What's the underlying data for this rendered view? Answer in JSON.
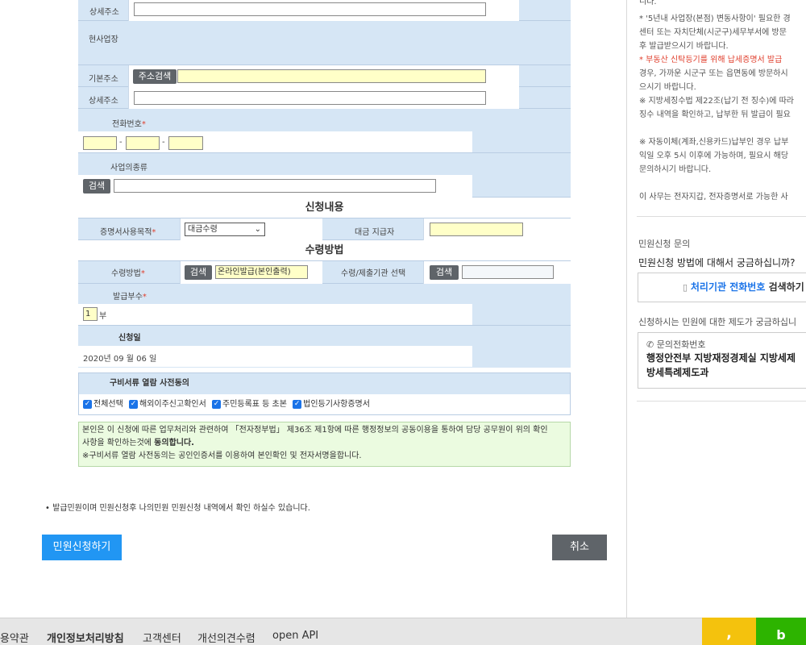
{
  "form": {
    "detail_addr_label_1": "상세주소",
    "workplace_label": "현사업장",
    "basic_addr_label": "기본주소",
    "addr_search_btn": "주소검색",
    "detail_addr_label_2": "상세주소",
    "phone_label": "전화번호",
    "phone_sep_1": "-",
    "phone_sep_2": "-",
    "business_type_label": "사업의종류",
    "search_btn": "검색",
    "section_apply": "신청내용",
    "purpose_label": "증명서사용목적",
    "purpose_value": "대금수령",
    "payer_label": "대금 지급자",
    "section_receive": "수령방법",
    "receive_method_label": "수령방법",
    "receive_search_btn": "검색",
    "receive_method_value": "온라인발급(본인출력)",
    "receive_org_label": "수령/제출기관 선택",
    "receive_org_search_btn": "검색",
    "copies_label": "발급부수",
    "copies_value": "1",
    "copies_unit": "부",
    "apply_date_label": "신청일",
    "apply_date_value": "2020년 09 월 06 일",
    "required_mark": "*"
  },
  "agreement": {
    "title": "구비서류 열람 사전동의",
    "items": [
      "전체선택",
      "해외이주신고확인서",
      "주민등록표 등 초본",
      "법인등기사항증명서"
    ]
  },
  "notice": {
    "line1": "본인은 이 신청에 따른 업무처리와 관련하여 「전자정부법」 제36조 제1항에 따른 행정정보의 공동이용을 통하여 담당 공무원이 위의 확인",
    "line2a": "사항을 확인하는것에 ",
    "line2b": "동의합니다.",
    "line3": "※구비서류 열람 사전동의는 공인인증서를 이용하여 본인확인 및 전자서명을합니다."
  },
  "bullet_note": "발급민원이며 민원신청후 나의민원 민원신청 내역에서 확인 하실수 있습니다.",
  "buttons": {
    "submit": "민원신청하기",
    "cancel": "취소"
  },
  "right": {
    "lines": [
      "니다.",
      " * '5년내 사업장(본점) 변동사항이' 필요한 경",
      "센터 또는 자치단체(시군구)세무부서에 방문",
      "후 발급받으시기 바랍니다.",
      " * 부동산 신탁등기를 위해 납세증명서 발급",
      "경우, 가까운 시군구 또는 읍면동에 방문하시",
      "으시기 바랍니다.",
      "※ 지방세징수법 제22조(납기 전 징수)에 따라",
      "징수 내역을 확인하고, 납부한 뒤 발급이 필요",
      "※ 자동이체(계좌,신용카드)납부인 경우 납부",
      "익일 오후 5시 이후에 가능하며, 필요시 해당",
      "문의하시기 바랍니다.",
      "이 사무는 전자지갑, 전자증명서로 가능한 사"
    ],
    "inquiry_title": "민원신청 문의",
    "inquiry_question": "민원신청 방법에 대해서 궁금하십니까?",
    "org_phone_blue": "처리기관 전화번호",
    "org_phone_rest": " 검색하기",
    "system_question": "신청하시는 민원에 대한 제도가 궁금하십니",
    "phone_title": "문의전화번호",
    "phone_org_1": "행정안전부 지방재정경제실 지방세제",
    "phone_org_2": "방세특례제도과"
  },
  "footer": {
    "links": [
      "이용약관",
      "개인정보처리방침",
      "고객센터",
      "개선의견수렴",
      "open API"
    ],
    "btn_yellow": ",",
    "btn_green": "b"
  },
  "colors": {
    "accent": "#2196f3",
    "form_bg": "#d6e6f5",
    "required": "#e0412f",
    "notice_bg": "#ebfbe0"
  }
}
